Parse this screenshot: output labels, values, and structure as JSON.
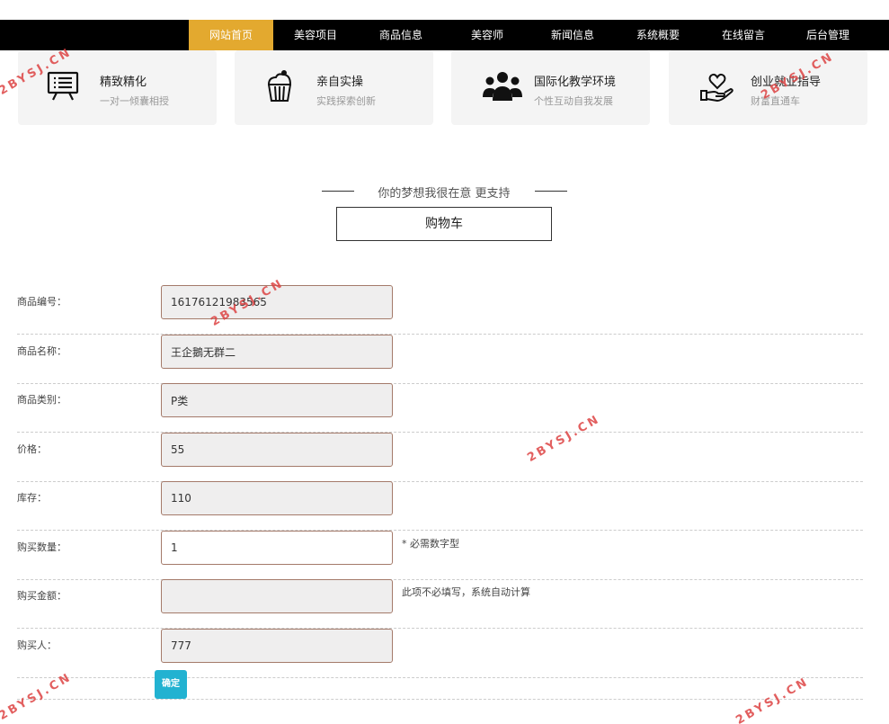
{
  "nav": {
    "items": [
      {
        "label": "网站首页",
        "active": true
      },
      {
        "label": "美容项目",
        "active": false
      },
      {
        "label": "商品信息",
        "active": false
      },
      {
        "label": "美容师",
        "active": false
      },
      {
        "label": "新闻信息",
        "active": false
      },
      {
        "label": "系统概要",
        "active": false
      },
      {
        "label": "在线留言",
        "active": false
      },
      {
        "label": "后台管理",
        "active": false
      }
    ],
    "active_color": "#e3a92f"
  },
  "features": [
    {
      "icon": "presentation-board-icon",
      "title": "精致精化",
      "subtitle": "一对一倾囊相授"
    },
    {
      "icon": "cupcake-icon",
      "title": "亲自实操",
      "subtitle": "实践探索创新"
    },
    {
      "icon": "people-group-icon",
      "title": "国际化教学环境",
      "subtitle": "个性互动自我发展"
    },
    {
      "icon": "heart-in-hand-icon",
      "title": "创业就业指导",
      "subtitle": "财富直通车"
    }
  ],
  "section": {
    "slogan": "你的梦想我很在意 更支持",
    "title": "购物车"
  },
  "form": {
    "fields": [
      {
        "label": "商品编号：",
        "value": "16176121983565",
        "editable": false,
        "hint": ""
      },
      {
        "label": "商品名称：",
        "value": "王企鵝无群二",
        "editable": false,
        "hint": ""
      },
      {
        "label": "商品类别：",
        "value": "P类",
        "editable": false,
        "hint": ""
      },
      {
        "label": "价格：",
        "value": "55",
        "editable": false,
        "hint": ""
      },
      {
        "label": "库存：",
        "value": "110",
        "editable": false,
        "hint": ""
      },
      {
        "label": "购买数量：",
        "value": "1",
        "editable": true,
        "hint": "* 必需数字型"
      },
      {
        "label": "购买金额：",
        "value": "",
        "editable": false,
        "hint": "此项不必填写，系统自动计算"
      },
      {
        "label": "购买人：",
        "value": "777",
        "editable": false,
        "hint": ""
      }
    ],
    "submit_label": "确定",
    "submit_color": "#22b2d1"
  },
  "watermark": {
    "text": "2BYSJ.CN"
  }
}
